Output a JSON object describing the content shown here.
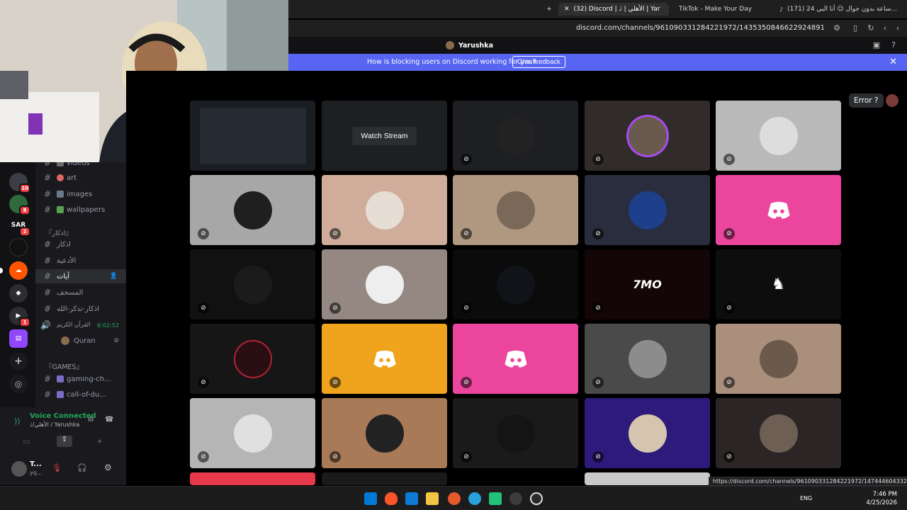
{
  "browser": {
    "tabs": [
      {
        "label": "(32) Discord | ♩ | الأهلي | Yar",
        "active": true
      },
      {
        "label": "TikTok - Make Your Day",
        "active": false
      },
      {
        "label": "(171) 24 ساعة بدون جوال ☺ أنا البي...",
        "active": false
      }
    ],
    "url": "discord.com/channels/961090331284221972/1435350846622924891",
    "hover_url": "https://discord.com/channels/961090331284221972/1474446043329655008"
  },
  "titlebar": {
    "user": "Yarushka"
  },
  "notice": {
    "text": "How is blocking users on Discord working for you?",
    "button": "Give feedback"
  },
  "stage": {
    "watch_stream": "Watch Stream",
    "error_label": "Error ?",
    "tile_7mo": "7MO"
  },
  "sidebar": {
    "servers": [
      {
        "badge": "10"
      },
      {
        "badge": "8"
      },
      {
        "label": "SAR",
        "badge": "2"
      },
      {
        "label": ""
      },
      {
        "label": ""
      },
      {
        "label": ""
      },
      {
        "label": "",
        "badge": "1"
      },
      {
        "label": ""
      }
    ],
    "channels": [
      {
        "name": "videos"
      },
      {
        "name": "art"
      },
      {
        "name": "images"
      },
      {
        "name": "wallpapers"
      },
      {
        "name": "اذكار"
      },
      {
        "name": "الأدعية"
      },
      {
        "name": "آيات"
      },
      {
        "name": "المسحف"
      },
      {
        "name": "اذكار-تذكر-الله"
      },
      {
        "name": "القرآن الكريم",
        "timer": "6:02:52"
      },
      {
        "name": "gaming-ch..."
      },
      {
        "name": "call-of-du..."
      }
    ],
    "categories": [
      {
        "label": "『اذكار』"
      },
      {
        "label": "『GAMES』"
      }
    ],
    "voice_user": "Quran"
  },
  "voice": {
    "status": "Voice Connected",
    "channel": "♩/الأهلي / Yarushka"
  },
  "user": {
    "name": "T...",
    "tag": "yq..."
  },
  "taskbar": {
    "lang": "ENG",
    "time": "7:46 PM",
    "date": "4/25/2026"
  },
  "colors": {
    "blurple": "#5865f2",
    "pink": "#eb459e",
    "yellow": "#f0a41d",
    "green": "#23a55a"
  }
}
